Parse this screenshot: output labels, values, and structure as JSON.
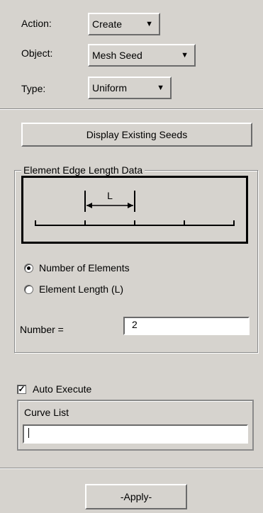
{
  "form": {
    "action": {
      "label": "Action:",
      "value": "Create"
    },
    "object": {
      "label": "Object:",
      "value": "Mesh Seed"
    },
    "type": {
      "label": "Type:",
      "value": "Uniform"
    }
  },
  "display_seeds_button": "Display Existing Seeds",
  "edge_length_group": {
    "title": "Element Edge Length Data",
    "diagram_label": "L",
    "radio_options": [
      {
        "label": "Number of Elements",
        "selected": true
      },
      {
        "label": "Element Length (L)",
        "selected": false
      }
    ],
    "number_label": "Number =",
    "number_value": "2"
  },
  "auto_execute": {
    "label": "Auto Execute",
    "checked": true
  },
  "curve_list": {
    "title": "Curve List",
    "value": ""
  },
  "apply_button": "-Apply-",
  "icons": {
    "dropdown": "triangle-down-icon",
    "checkmark": "checkmark-icon"
  }
}
